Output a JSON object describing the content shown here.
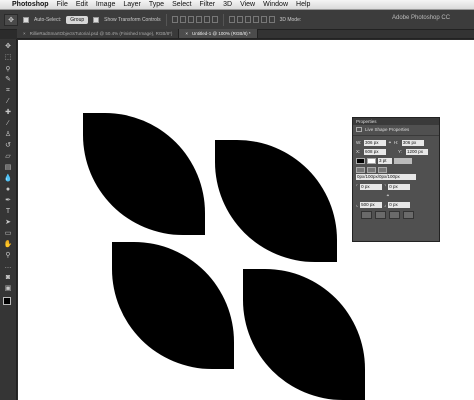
{
  "menubar": {
    "apple": "",
    "app_name": "Photoshop",
    "items": [
      "File",
      "Edit",
      "Image",
      "Layer",
      "Type",
      "Select",
      "Filter",
      "3D",
      "View",
      "Window",
      "Help"
    ]
  },
  "options": {
    "auto_select_label": "Auto-Select:",
    "auto_select_value": "Group",
    "show_transform_label": "Show Transform Controls",
    "mode_3d": "3D Mode:",
    "window_title": "Adobe Photoshop CC"
  },
  "tabs": [
    {
      "label": "RillieRadSmartObjectsTutorial.psd @ 50.4% (Finished Image), RGB/8*)",
      "close": "×"
    },
    {
      "label": "Untitled-1 @ 100% (RGB/8) *",
      "close": "×"
    }
  ],
  "toolbox": {
    "icons": [
      "move",
      "marquee",
      "lasso",
      "quick-select",
      "crop",
      "eyedropper",
      "healing",
      "brush",
      "stamp",
      "history-brush",
      "eraser",
      "gradient",
      "blur",
      "dodge",
      "pen",
      "type",
      "path-select",
      "shape",
      "hand",
      "zoom",
      "more",
      "quick-mask",
      "screen-mode"
    ]
  },
  "properties": {
    "title": "Properties",
    "header": "Live Shape Properties",
    "w_label": "W:",
    "w_value": "306 px",
    "h_label": "H:",
    "h_value": "306 px",
    "x_label": "X:",
    "x_value": "608 px",
    "y_label": "Y:",
    "y_value": "1200 px",
    "stroke_width": "3 pt",
    "corner_line": "0px/100px/0px/100px",
    "tl": "0 px",
    "tr": "0 px",
    "bl": "500 px",
    "br": "0 px"
  }
}
